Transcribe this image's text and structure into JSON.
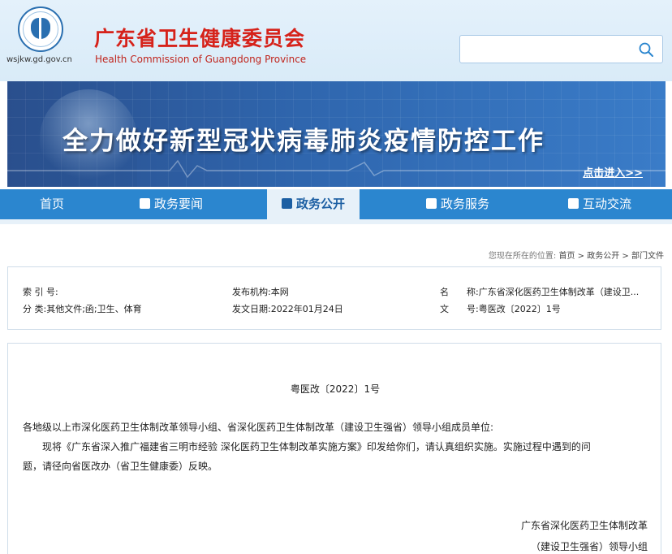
{
  "header": {
    "domain": "wsjkw.gd.gov.cn",
    "title": "广东省卫生健康委员会",
    "subtitle": "Health Commission of Guangdong Province",
    "search_placeholder": ""
  },
  "banner": {
    "headline": "全力做好新型冠状病毒肺炎疫情防控工作",
    "link": "点击进入>>"
  },
  "nav": {
    "items": [
      {
        "label": "首页"
      },
      {
        "label": "政务要闻"
      },
      {
        "label": "政务公开"
      },
      {
        "label": "政务服务"
      },
      {
        "label": "互动交流"
      }
    ]
  },
  "breadcrumb": {
    "label": "您现在所在的位置:",
    "path": [
      "首页",
      "政务公开",
      "部门文件"
    ],
    "sep": ">"
  },
  "meta": {
    "index_label": "索 引 号:",
    "index_value": "",
    "category_label": "分 类:",
    "category_value": "其他文件;函;卫生、体育",
    "publisher_label": "发布机构:",
    "publisher_value": "本网",
    "date_label": "发文日期:",
    "date_value": "2022年01月24日",
    "name_label": "名　　称:",
    "name_value": "广东省深化医药卫生体制改革（建设卫...",
    "docno_label": "文　　号:",
    "docno_value": "粤医改〔2022〕1号"
  },
  "doc": {
    "number": "粤医改〔2022〕1号",
    "addressee": "各地级以上市深化医药卫生体制改革领导小组、省深化医药卫生体制改革（建设卫生强省）领导小组成员单位:",
    "body_line1": "现将《广东省深入推广福建省三明市经验 深化医药卫生体制改革实施方案》印发给你们，请认真组织实施。实施过程中遇到的问",
    "body_line2": "题，请径向省医改办（省卫生健康委）反映。",
    "sign_line1": "广东省深化医药卫生体制改革",
    "sign_line2": "（建设卫生强省）领导小组"
  }
}
